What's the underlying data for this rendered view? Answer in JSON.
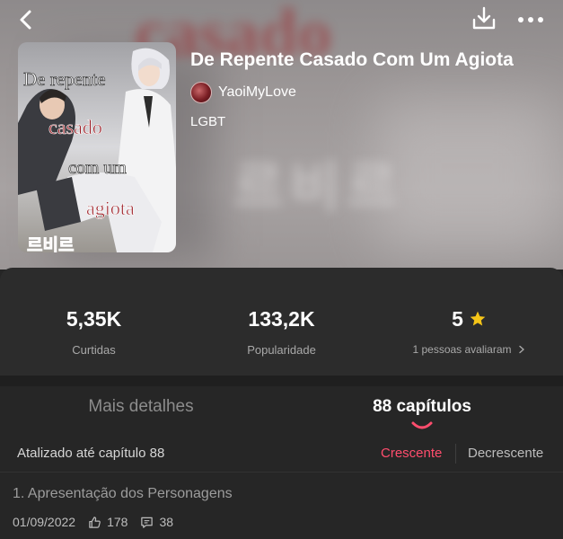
{
  "book": {
    "title": "De Repente Casado Com Um Agiota",
    "author": "YaoiMyLove",
    "genre": "LGBT",
    "cover_text": [
      "De repente",
      "casado",
      "com um",
      "agiota",
      "르비르"
    ]
  },
  "header": {
    "back_icon": "chevron-left-icon",
    "download_icon": "download-icon",
    "more_icon": "more-dots-icon"
  },
  "stats": {
    "likes": {
      "value": "5,35K",
      "label": "Curtidas"
    },
    "popularity": {
      "value": "133,2K",
      "label": "Popularidade"
    },
    "rating": {
      "value": "5",
      "label": "1 pessoas avaliaram"
    }
  },
  "tabs": {
    "details": "Mais detalhes",
    "chapters": "88 capítulos",
    "active": "chapters"
  },
  "sort": {
    "updated": "Atalizado até capítulo 88",
    "ascending": "Crescente",
    "descending": "Decrescente",
    "active": "ascending"
  },
  "chapters": [
    {
      "title": "1. Apresentação dos Personagens",
      "date": "01/09/2022",
      "likes": "178",
      "comments": "38"
    }
  ],
  "colors": {
    "accent": "#ff4d6d",
    "star": "#f5c518",
    "background": "#262626"
  }
}
